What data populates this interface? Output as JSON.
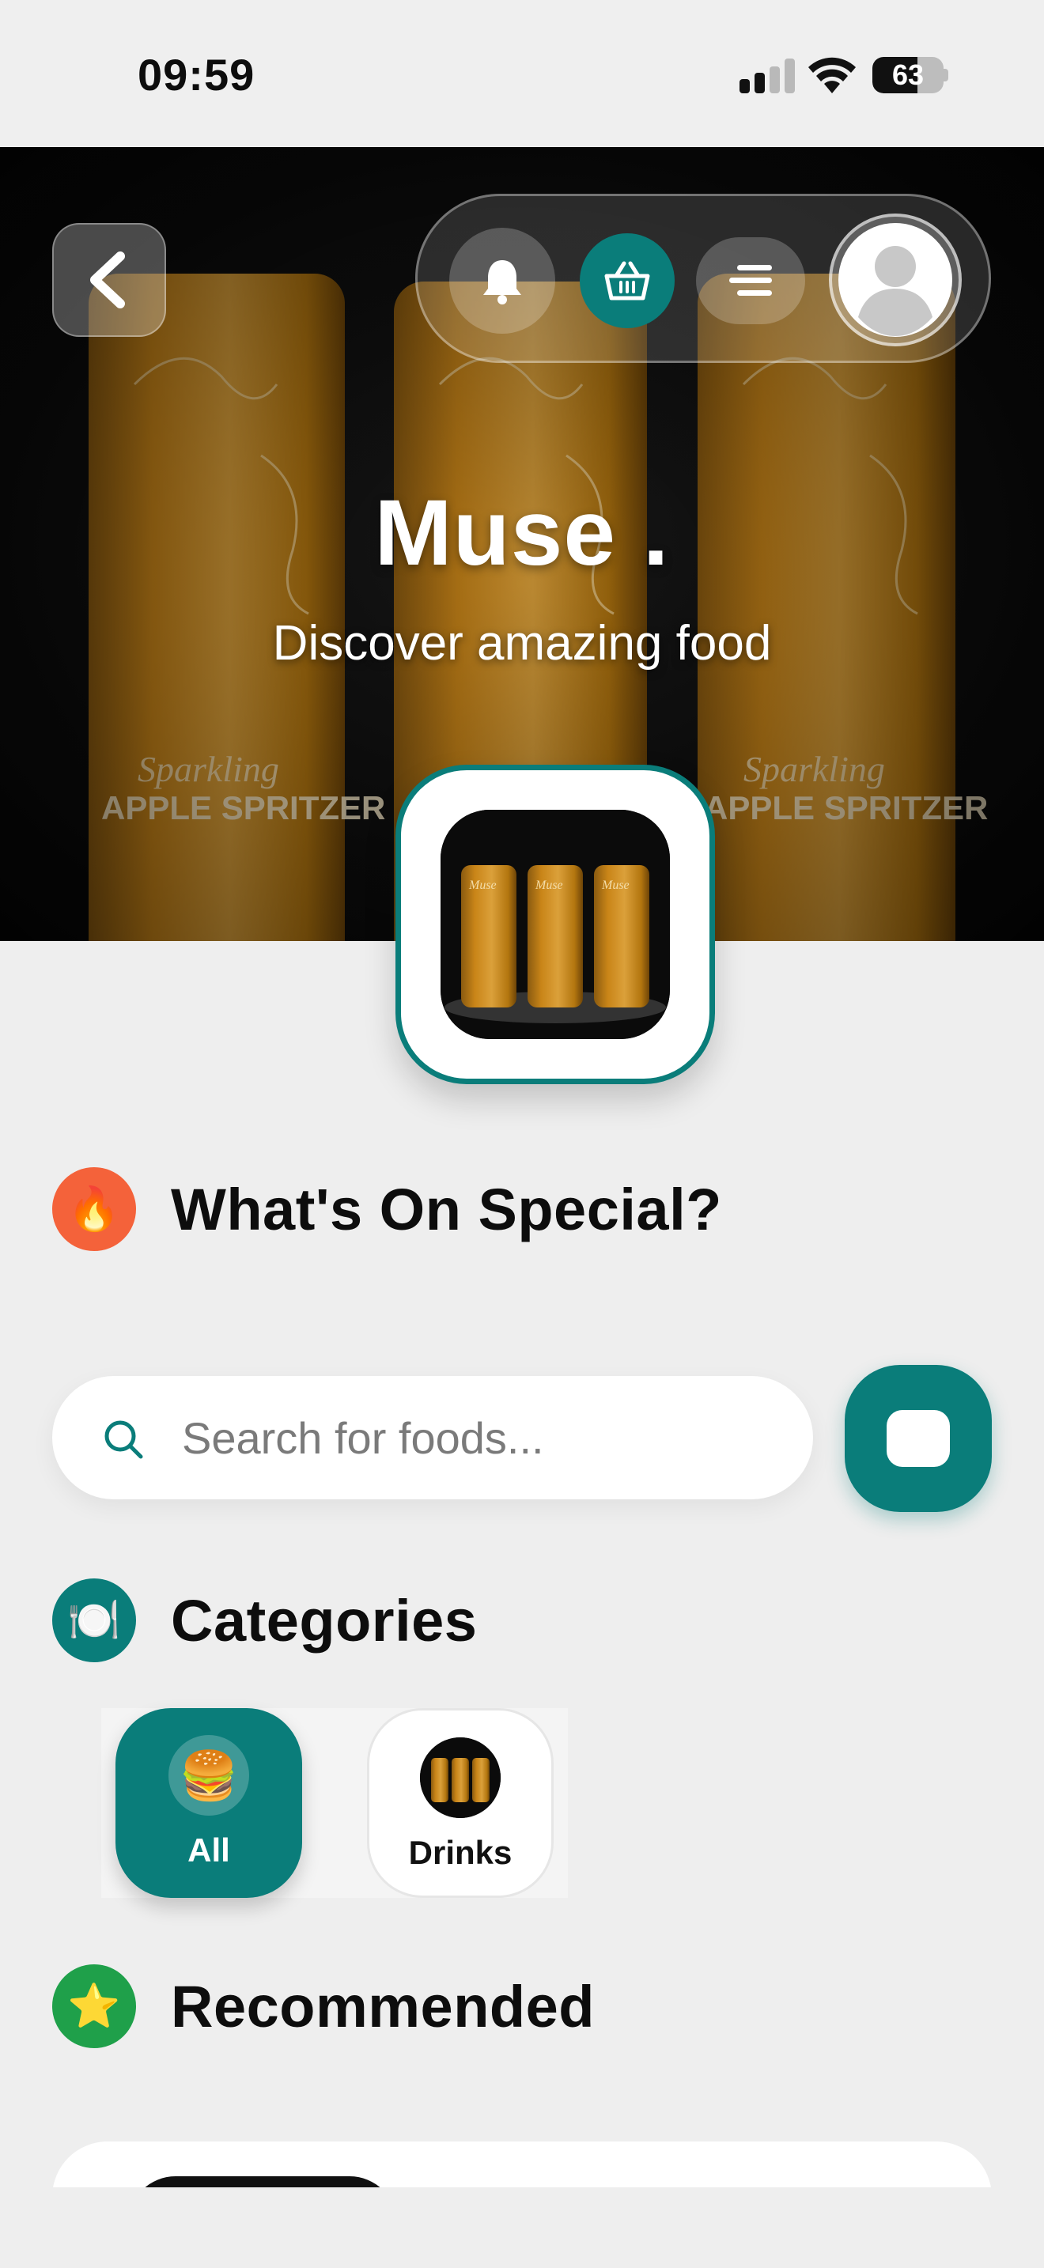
{
  "status_bar": {
    "time": "09:59",
    "battery_level": 63,
    "battery_text": "63"
  },
  "hero": {
    "title": "Muse .",
    "subtitle": "Discover amazing food"
  },
  "header": {
    "back_icon": "chevron-left-icon",
    "notification_icon": "bell-icon",
    "basket_icon": "basket-icon",
    "menu_icon": "menu-icon",
    "avatar_icon": "user-avatar-icon"
  },
  "special": {
    "title": "What's On Special?",
    "icon": "🔥"
  },
  "search": {
    "placeholder": "Search for foods..."
  },
  "categories": {
    "title": "Categories",
    "icon": "🍽️",
    "items": [
      {
        "label": "All",
        "emoji": "🍔",
        "selected": true
      },
      {
        "label": "Drinks",
        "selected": false
      }
    ]
  },
  "recommended": {
    "title": "Recommended",
    "icon": "⭐"
  },
  "colors": {
    "accent": "#0a7d7a",
    "can": "#d8901c",
    "background": "#eeeeee"
  }
}
